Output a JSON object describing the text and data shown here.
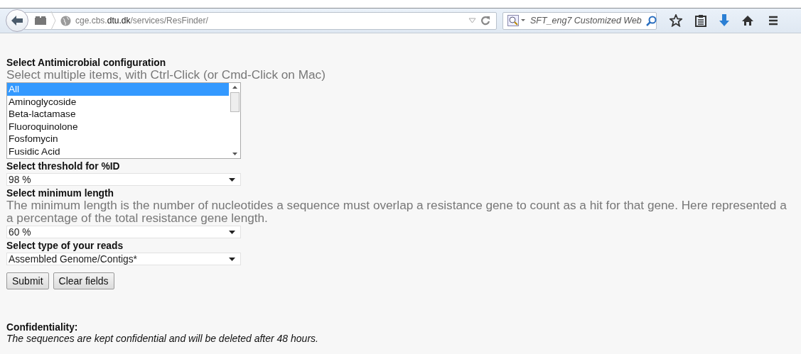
{
  "browser": {
    "url": "cge.cbs.**dtu.dk**/services/ResFinder/",
    "search_placeholder": "SFT_eng7 Customized Web"
  },
  "form": {
    "antimicrobial": {
      "label": "Select Antimicrobial configuration",
      "hint": "Select multiple items, with Ctrl-Click (or Cmd-Click on Mac)",
      "options": [
        {
          "label": "All",
          "selected": true
        },
        {
          "label": "Aminoglycoside",
          "selected": false
        },
        {
          "label": "Beta-lactamase",
          "selected": false
        },
        {
          "label": "Fluoroquinolone",
          "selected": false
        },
        {
          "label": "Fosfomycin",
          "selected": false
        },
        {
          "label": "Fusidic Acid",
          "selected": false
        }
      ]
    },
    "threshold": {
      "label": "Select threshold for %ID",
      "value": "98 %"
    },
    "min_length": {
      "label": "Select minimum length",
      "description": [
        "The minimum length is the number of nucleotides a sequence must overlap a resistance gene to count as a hit for that gene. Here represented a",
        "a percentage of the total resistance gene length."
      ],
      "value": "60 %"
    },
    "read_type": {
      "label": "Select type of your reads",
      "value": "Assembled Genome/Contigs*"
    },
    "buttons": [
      "Submit",
      "Clear fields"
    ]
  },
  "confidentiality": {
    "title": "Confidentiality:",
    "text": "The sequences are kept confidential and will be deleted after 48 hours."
  }
}
